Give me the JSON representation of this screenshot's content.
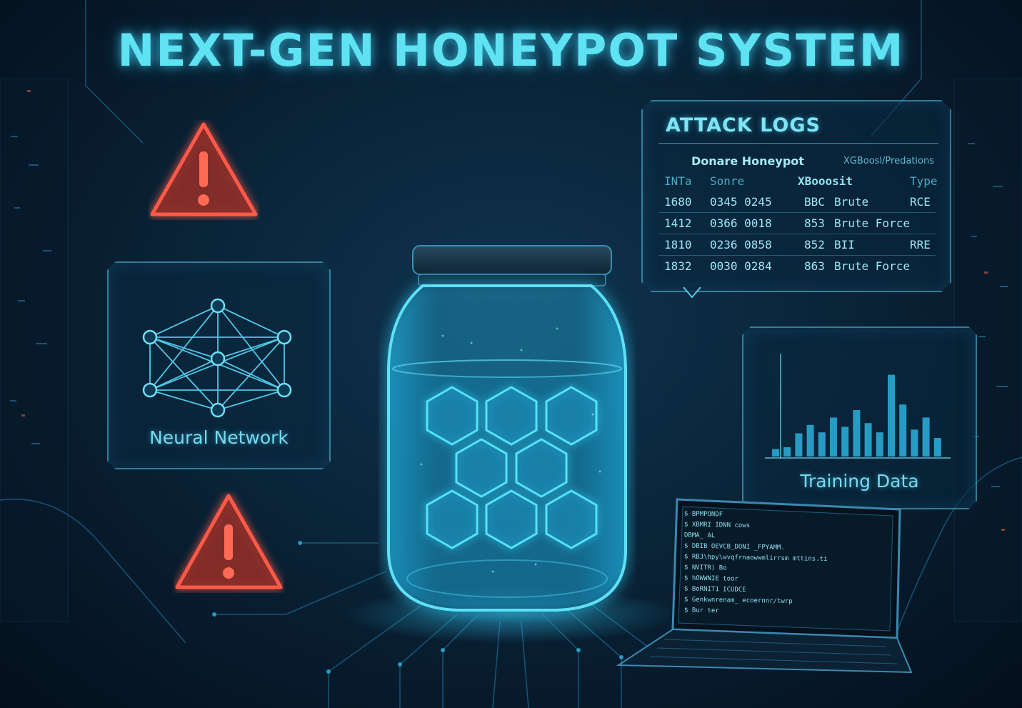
{
  "title": "NEXT-GEN HONEYPOT SYSTEM",
  "neural_network": {
    "label": "Neural Network",
    "icon": "neural-network-icon"
  },
  "attack_logs": {
    "title": "ATTACK LOGS",
    "subtitle_left": "Donare Honeypot",
    "subtitle_right": "XGBoosl/Predations",
    "headers": [
      "INTa",
      "Sonre",
      "XBooosit",
      "Type"
    ],
    "rows": [
      [
        "1680",
        "0345 0245",
        "BBC",
        "Brute",
        "RCE"
      ],
      [
        "1412",
        "0366 0018",
        "853",
        "Brute Force",
        ""
      ],
      [
        "1810",
        "0236 0858",
        "852",
        "BII",
        "RRE"
      ],
      [
        "1832",
        "0030 0284",
        "863",
        "Brute Force",
        ""
      ]
    ]
  },
  "training_data": {
    "label": "Training Data",
    "bars": [
      0.08,
      0.1,
      0.25,
      0.34,
      0.26,
      0.42,
      0.32,
      0.5,
      0.36,
      0.26,
      0.88,
      0.56,
      0.29,
      0.42,
      0.2
    ]
  },
  "terminal_lines": [
    "$ BPMPONDF",
    "$ XBMRI  IDNN cows",
    "  DBMA_ AL",
    "$ DBIB   OEVCB_DONI _FPYAMM.",
    "$ RBJ\\hpy\\wvqfrnaowwmlirrsm mttins.ti",
    "$ NVITR) Bo",
    "$ hOWWNIE toor",
    "$ BoRNIT1 ICUDCE",
    "$ Genkwnrenam_ ecoernnr/twrp",
    "$ Bur ter"
  ],
  "colors": {
    "accent": "#5fe3f2",
    "warning": "#ff5a47",
    "panel_border": "#5ac8e6"
  }
}
